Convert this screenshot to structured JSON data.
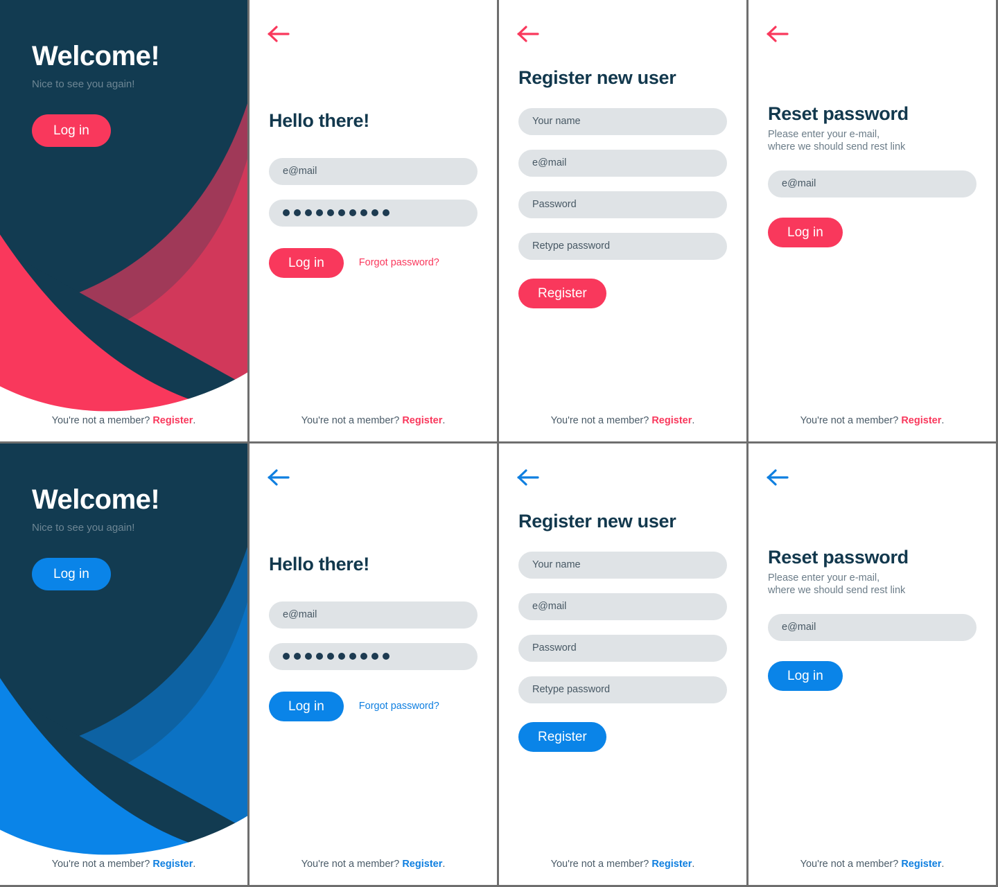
{
  "theme": {
    "pink": "#f9385c",
    "blue": "#0a84e8",
    "navy": "#123b51",
    "field_bg": "#dfe3e6",
    "heading": "#12384d",
    "muted": "#6b7c88",
    "link_pink": "#f9385c",
    "link_blue": "#0f7fe0"
  },
  "footer": {
    "prefix": "You're not a member? ",
    "link": "Register",
    "suffix": "."
  },
  "welcome": {
    "title": "Welcome!",
    "subtitle": "Nice to see you again!",
    "login_label": "Log in"
  },
  "login": {
    "heading": "Hello there!",
    "email_placeholder": "e@mail",
    "password_value": "••••••••••",
    "password_dots": 10,
    "login_label": "Log in",
    "forgot_label": "Forgot password?",
    "back_icon": "arrow-left-icon"
  },
  "register": {
    "heading": "Register new user",
    "name_placeholder": "Your name",
    "email_placeholder": "e@mail",
    "password_placeholder": "Password",
    "retype_placeholder": "Retype password",
    "submit_label": "Register",
    "back_icon": "arrow-left-icon"
  },
  "reset": {
    "heading": "Reset password",
    "subtitle_line1": "Please enter your e-mail,",
    "subtitle_line2": "where we should send rest link",
    "email_placeholder": "e@mail",
    "submit_label": "Log in",
    "back_icon": "arrow-left-icon"
  }
}
